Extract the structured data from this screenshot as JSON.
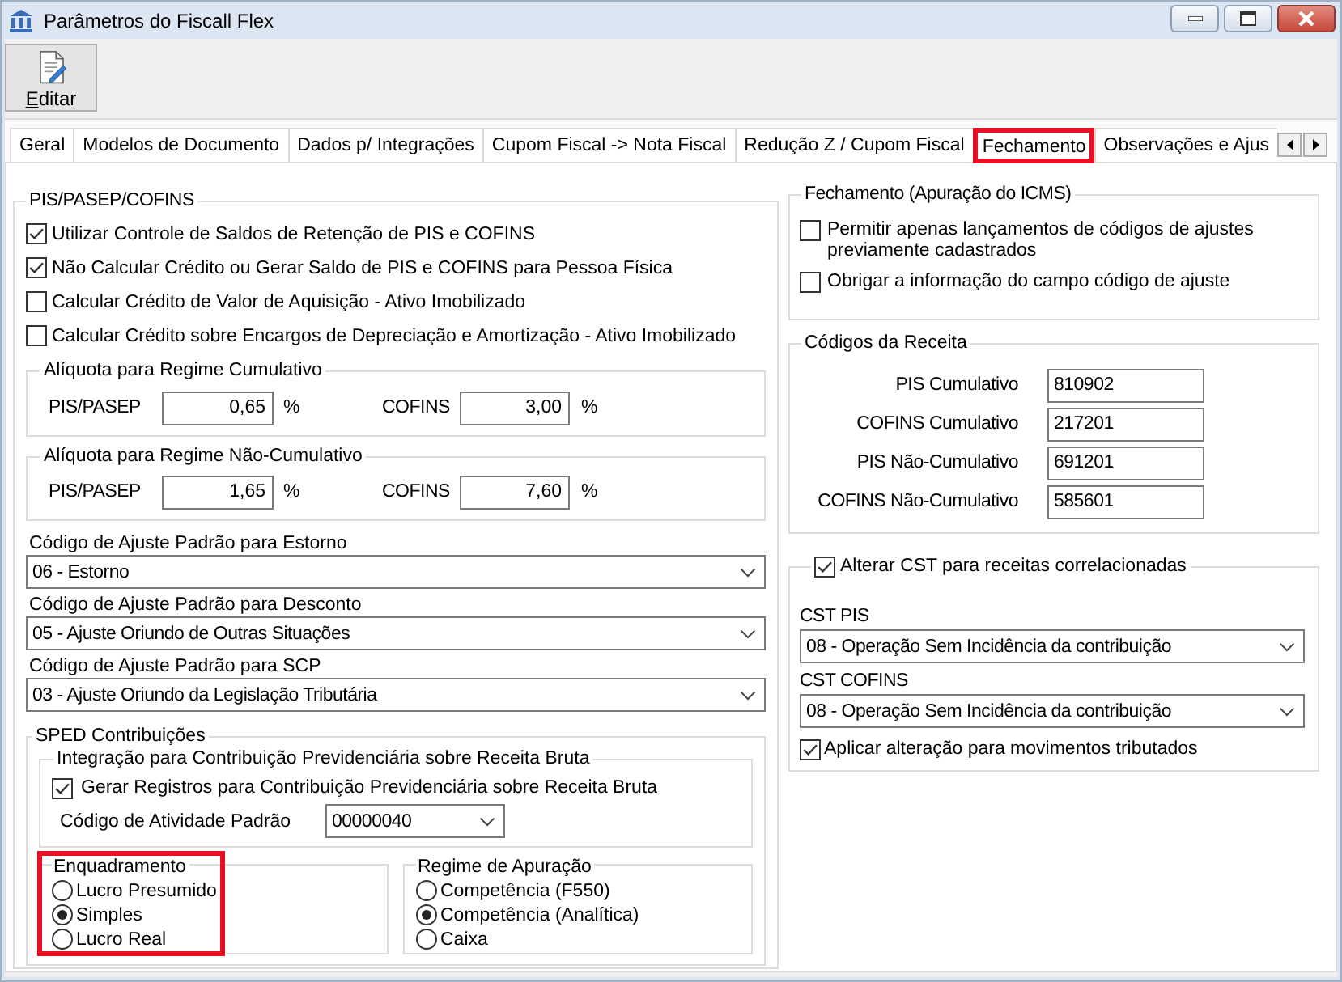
{
  "window": {
    "title": "Parâmetros do Fiscall Flex"
  },
  "toolbar": {
    "buttons": [
      {
        "label": "Editar"
      }
    ]
  },
  "tabs": [
    {
      "label": "Geral",
      "selected": false,
      "highlighted": false
    },
    {
      "label": "Modelos de Documento",
      "selected": false,
      "highlighted": false
    },
    {
      "label": "Dados p/ Integrações",
      "selected": false,
      "highlighted": false
    },
    {
      "label": "Cupom Fiscal -> Nota Fiscal",
      "selected": false,
      "highlighted": false
    },
    {
      "label": "Redução Z / Cupom Fiscal",
      "selected": false,
      "highlighted": false
    },
    {
      "label": "Fechamento",
      "selected": true,
      "highlighted": true
    },
    {
      "label": "Observações e Ajus",
      "selected": false,
      "highlighted": false
    }
  ],
  "pis_cofins": {
    "title": "PIS/PASEP/COFINS",
    "options": [
      {
        "label": "Utilizar Controle de Saldos de Retenção de PIS e COFINS",
        "checked": true
      },
      {
        "label": "Não Calcular Crédito ou Gerar Saldo de PIS e COFINS para Pessoa Física",
        "checked": true
      },
      {
        "label": "Calcular Crédito de Valor de Aquisição - Ativo Imobilizado",
        "checked": false
      },
      {
        "label": "Calcular Crédito sobre Encargos de Depreciação e Amortização - Ativo Imobilizado",
        "checked": false
      }
    ],
    "rate_groups": [
      {
        "title": "Alíquota para Regime Cumulativo",
        "fields": [
          {
            "label": "PIS/PASEP",
            "value": "0,65",
            "unit": "%"
          },
          {
            "label": "COFINS",
            "value": "3,00",
            "unit": "%"
          }
        ]
      },
      {
        "title": "Alíquota para Regime Não-Cumulativo",
        "fields": [
          {
            "label": "PIS/PASEP",
            "value": "1,65",
            "unit": "%"
          },
          {
            "label": "COFINS",
            "value": "7,60",
            "unit": "%"
          }
        ]
      }
    ],
    "adjustment_codes": [
      {
        "label": "Código de Ajuste Padrão para Estorno",
        "value": "06 - Estorno"
      },
      {
        "label": "Código de Ajuste Padrão para Desconto",
        "value": "05 - Ajuste Oriundo de Outras Situações"
      },
      {
        "label": "Código de Ajuste Padrão para SCP",
        "value": "03 - Ajuste Oriundo da Legislação Tributária"
      }
    ],
    "sped": {
      "title": "SPED Contribuições",
      "integration": {
        "title": "Integração para Contribuição Previdenciária sobre Receita Bruta",
        "option": {
          "label": "Gerar Registros para Contribuição Previdenciária sobre Receita Bruta",
          "checked": true
        },
        "activity_code": {
          "label": "Código de Atividade Padrão",
          "value": "00000040"
        }
      },
      "radio_groups": [
        {
          "title": "Enquadramento",
          "highlighted": true,
          "options": [
            {
              "label": "Lucro Presumido",
              "selected": false
            },
            {
              "label": "Simples",
              "selected": true
            },
            {
              "label": "Lucro Real",
              "selected": false
            }
          ]
        },
        {
          "title": "Regime de Apuração",
          "highlighted": false,
          "options": [
            {
              "label": "Competência (F550)",
              "selected": false
            },
            {
              "label": "Competência (Analítica)",
              "selected": true
            },
            {
              "label": "Caixa",
              "selected": false
            }
          ]
        }
      ]
    }
  },
  "icms_closing": {
    "title": "Fechamento (Apuração do ICMS)",
    "options": [
      {
        "label": "Permitir apenas lançamentos de códigos de ajustes previamente cadastrados",
        "checked": false
      },
      {
        "label": "Obrigar a informação do campo código de ajuste",
        "checked": false
      }
    ]
  },
  "revenue_codes": {
    "title": "Códigos da Receita",
    "fields": [
      {
        "label": "PIS Cumulativo",
        "value": "810902"
      },
      {
        "label": "COFINS Cumulativo",
        "value": "217201"
      },
      {
        "label": "PIS Não-Cumulativo",
        "value": "691201"
      },
      {
        "label": "COFINS Não-Cumulativo",
        "value": "585601"
      }
    ]
  },
  "cst": {
    "toggle": {
      "label": "Alterar CST para receitas correlacionadas",
      "checked": true
    },
    "selects": [
      {
        "label": "CST PIS",
        "value": "08 - Operação Sem Incidência da contribuição"
      },
      {
        "label": "CST COFINS",
        "value": "08 - Operação Sem Incidência da contribuição"
      }
    ],
    "apply": {
      "label": "Aplicar alteração para movimentos tributados",
      "checked": true
    }
  }
}
